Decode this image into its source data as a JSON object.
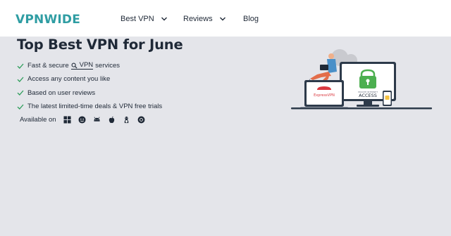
{
  "brand": {
    "logo_text": "VPNWIDE",
    "color": "#2f9da3"
  },
  "nav": {
    "items": [
      {
        "label": "Best VPN",
        "has_dropdown": true
      },
      {
        "label": "Reviews",
        "has_dropdown": true
      },
      {
        "label": "Blog",
        "has_dropdown": false
      }
    ]
  },
  "hero": {
    "title": "Top Best VPN for June",
    "features": [
      {
        "before": "Fast & secure",
        "term": "VPN",
        "after": "services"
      },
      {
        "text": "Access any content you like"
      },
      {
        "text": "Based on user reviews"
      },
      {
        "text": "The latest limited-time deals & VPN free trials"
      }
    ],
    "check_color": "#2e9e5b",
    "available_label": "Available on",
    "platform_icons": [
      "windows-icon",
      "macos-finder-icon",
      "android-icon",
      "apple-icon",
      "linux-icon",
      "chrome-icon"
    ]
  },
  "illustration": {
    "laptop_brand": "ExpressVPN",
    "monitor_label": "ACCESS",
    "monitor_caption": "PRIVATE INTERNET"
  }
}
